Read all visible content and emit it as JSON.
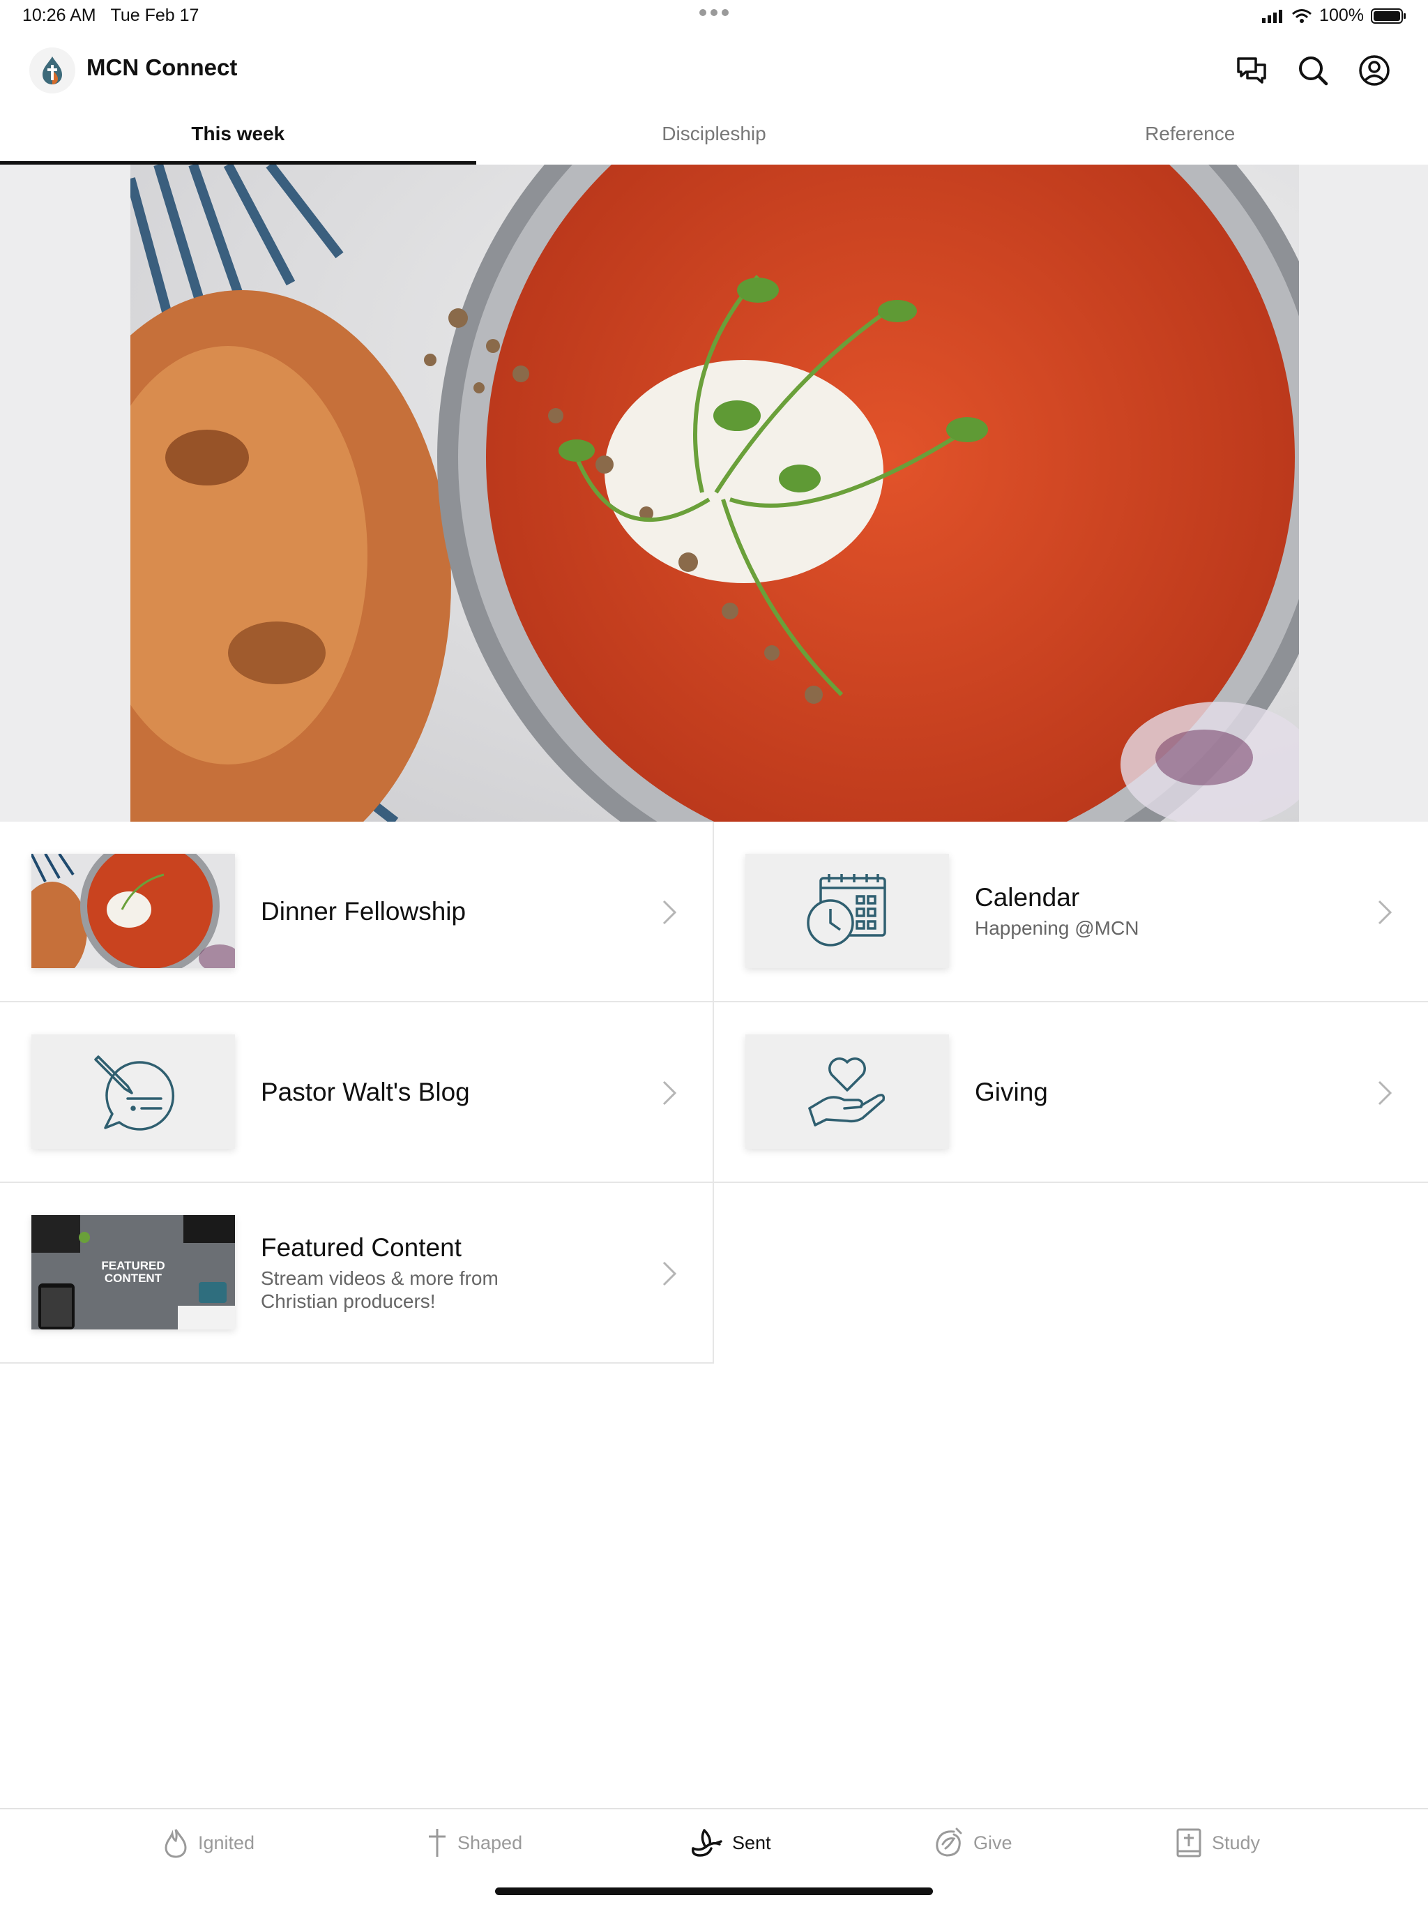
{
  "status_bar": {
    "time": "10:26 AM",
    "date": "Tue Feb 17",
    "battery": "100%"
  },
  "app": {
    "title": "MCN Connect"
  },
  "header_icons": [
    "chat-icon",
    "search-icon",
    "profile-icon"
  ],
  "tabs": [
    {
      "label": "This week",
      "active": true
    },
    {
      "label": "Discipleship",
      "active": false
    },
    {
      "label": "Reference",
      "active": false
    }
  ],
  "cards": [
    {
      "title": "Dinner Fellowship",
      "subtitle": ""
    },
    {
      "title": "Calendar",
      "subtitle": "Happening @MCN"
    },
    {
      "title": "Pastor Walt's Blog",
      "subtitle": ""
    },
    {
      "title": "Giving",
      "subtitle": ""
    },
    {
      "title": "Featured Content",
      "subtitle": "Stream videos & more from Christian producers!",
      "thumb_text": "FEATURED CONTENT"
    }
  ],
  "bottom_nav": [
    {
      "label": "Ignited",
      "icon": "flame-icon",
      "active": false
    },
    {
      "label": "Shaped",
      "icon": "cross-icon",
      "active": false
    },
    {
      "label": "Sent",
      "icon": "dove-icon",
      "active": true
    },
    {
      "label": "Give",
      "icon": "give-icon",
      "active": false
    },
    {
      "label": "Study",
      "icon": "bible-icon",
      "active": false
    }
  ],
  "colors": {
    "accent": "#2f5f70",
    "text": "#111111",
    "muted": "#9a9a9a"
  }
}
